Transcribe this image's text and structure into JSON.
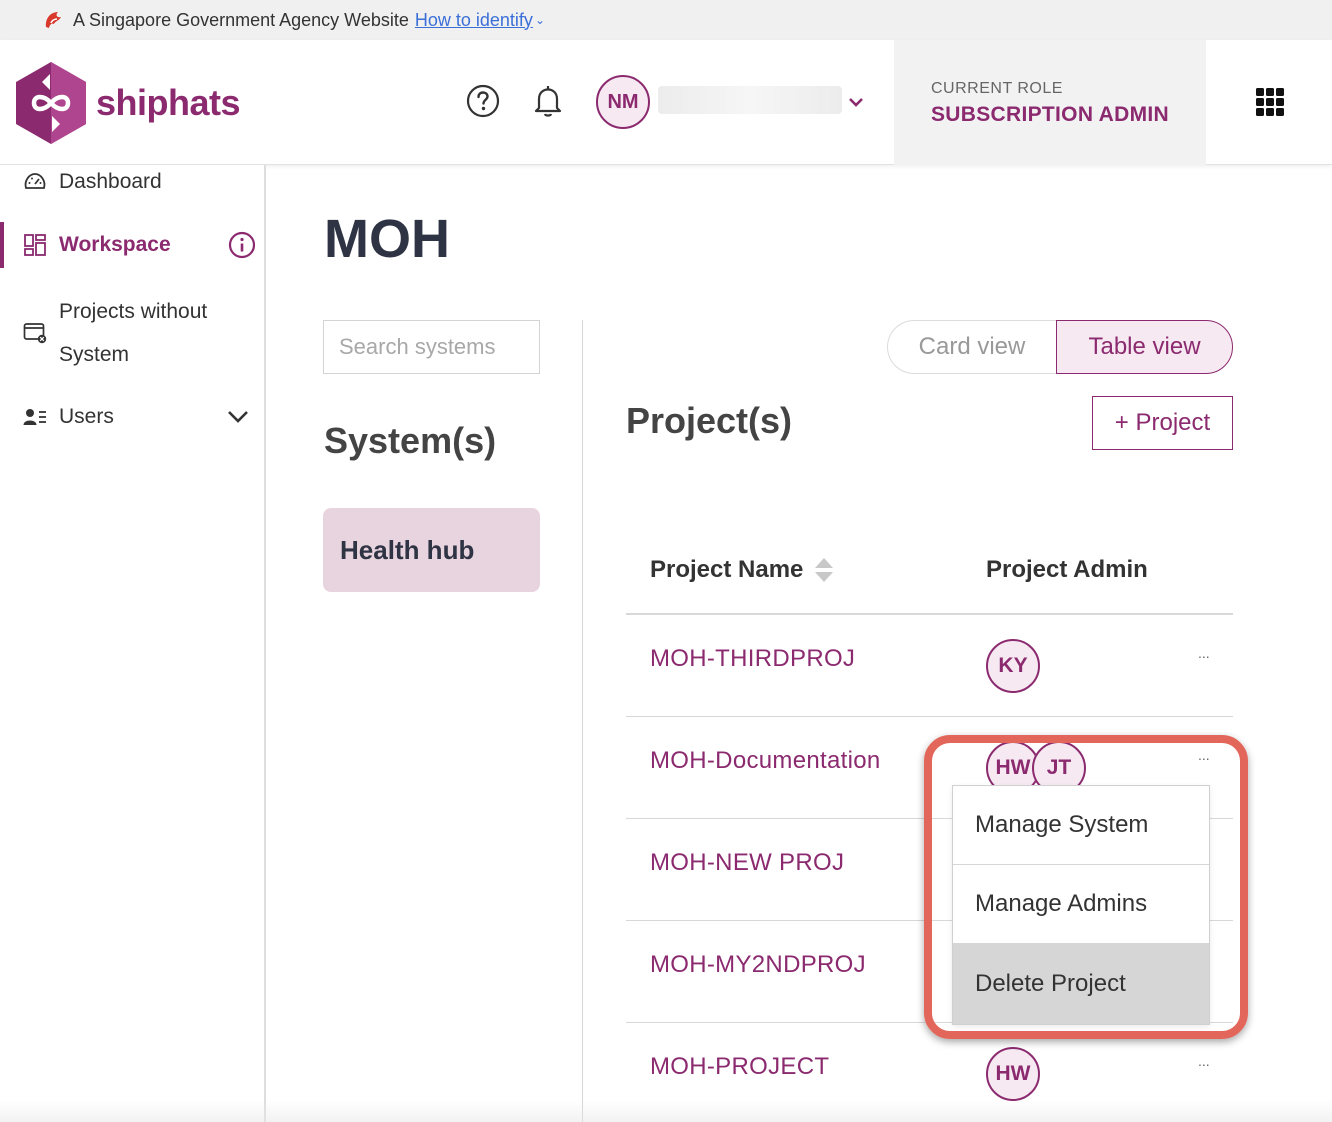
{
  "gov_banner": {
    "text": "A Singapore Government Agency Website",
    "link": "How to identify"
  },
  "header": {
    "logo_text": "shiphats",
    "user_initials": "NM",
    "current_role_label": "CURRENT ROLE",
    "current_role_value": "SUBSCRIPTION ADMIN"
  },
  "sidebar": {
    "items": [
      {
        "label": "Dashboard"
      },
      {
        "label": "Workspace"
      },
      {
        "label": "Projects without System"
      },
      {
        "label": "Users"
      }
    ]
  },
  "main": {
    "title": "MOH",
    "search_placeholder": "Search systems",
    "systems_heading": "System(s)",
    "systems": [
      {
        "name": "Health hub"
      }
    ],
    "view_toggle": {
      "card": "Card view",
      "table": "Table view",
      "selected": "Table view"
    },
    "projects_heading": "Project(s)",
    "add_project_label": "+ Project",
    "table": {
      "headers": [
        "Project Name",
        "Project Admin"
      ],
      "rows": [
        {
          "name": "MOH-THIRDPROJ",
          "admins": [
            "KY"
          ],
          "more": "..."
        },
        {
          "name": "MOH-Documentation",
          "admins": [
            "HW",
            "JT"
          ],
          "more": "..."
        },
        {
          "name": "MOH-NEW PROJ",
          "admins": [],
          "more": "..."
        },
        {
          "name": "MOH-MY2NDPROJ",
          "admins": [],
          "more": "..."
        },
        {
          "name": "MOH-PROJECT",
          "admins": [
            "HW"
          ],
          "more": "..."
        }
      ]
    }
  },
  "dropdown": {
    "items": [
      "Manage System",
      "Manage Admins",
      "Delete Project"
    ],
    "highlighted": "Delete Project"
  },
  "colors": {
    "brand": "#8b2a6f",
    "brand_light": "#f7e9f1",
    "system_card": "#e8d4df",
    "annotation": "#e3665a"
  }
}
